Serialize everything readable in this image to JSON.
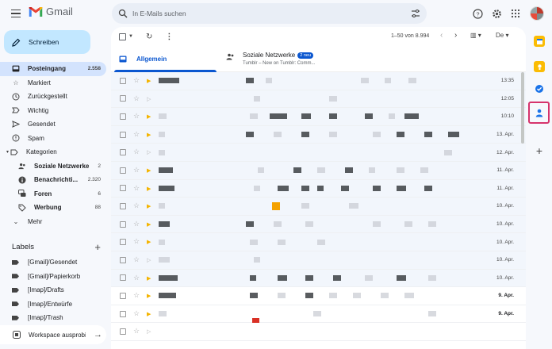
{
  "app": {
    "name": "Gmail"
  },
  "search": {
    "placeholder": "In E-Mails suchen"
  },
  "compose": {
    "label": "Schreiben"
  },
  "nav": [
    {
      "label": "Posteingang",
      "count": "2.558",
      "icon": "inbox-icon",
      "active": true
    },
    {
      "label": "Markiert",
      "count": "",
      "icon": "star-icon"
    },
    {
      "label": "Zurückgestellt",
      "count": "",
      "icon": "clock-icon"
    },
    {
      "label": "Wichtig",
      "count": "",
      "icon": "important-icon"
    },
    {
      "label": "Gesendet",
      "count": "",
      "icon": "send-icon"
    },
    {
      "label": "Spam",
      "count": "",
      "icon": "spam-icon"
    },
    {
      "label": "Kategorien",
      "count": "",
      "icon": "label-icon"
    }
  ],
  "categories": [
    {
      "label": "Soziale Netzwerke",
      "count": "2",
      "icon": "people-icon"
    },
    {
      "label": "Benachrichti...",
      "count": "2.320",
      "icon": "info-icon"
    },
    {
      "label": "Foren",
      "count": "6",
      "icon": "forum-icon"
    },
    {
      "label": "Werbung",
      "count": "88",
      "icon": "tag-icon"
    }
  ],
  "more": {
    "label": "Mehr"
  },
  "labels": {
    "title": "Labels",
    "items": [
      "[Gmail]/Gesendet",
      "[Gmail]/Papierkorb",
      "[Imap]/Drafts",
      "[Imap]/Entwürfe",
      "[Imap]/Trash"
    ]
  },
  "workspace": {
    "label": "Workspace ausprobieren"
  },
  "toolbar": {
    "pagination": "1–50 von 8.994",
    "lang": "De"
  },
  "tabs": {
    "primary": "Allgemein",
    "social": "Soziale Netzwerke",
    "social_badge": "2 neu",
    "social_sub": "Tumblr – New on Tumblr: Comm..."
  },
  "emails": [
    {
      "date": "13:35",
      "important": true,
      "read": true
    },
    {
      "date": "12:05",
      "important": false,
      "read": true
    },
    {
      "date": "10:10",
      "important": true,
      "read": true
    },
    {
      "date": "13. Apr.",
      "important": true,
      "read": true
    },
    {
      "date": "12. Apr.",
      "important": false,
      "read": true
    },
    {
      "date": "11. Apr.",
      "important": true,
      "read": true
    },
    {
      "date": "11. Apr.",
      "important": true,
      "read": true
    },
    {
      "date": "10. Apr.",
      "important": true,
      "read": true
    },
    {
      "date": "10. Apr.",
      "important": true,
      "read": true
    },
    {
      "date": "10. Apr.",
      "important": true,
      "read": true
    },
    {
      "date": "10. Apr.",
      "important": false,
      "read": true
    },
    {
      "date": "10. Apr.",
      "important": true,
      "read": true
    },
    {
      "date": "9. Apr.",
      "important": true,
      "read": false
    },
    {
      "date": "9. Apr.",
      "important": true,
      "read": false
    },
    {
      "date": "",
      "important": false,
      "read": false
    }
  ],
  "colors": {
    "accent": "#0b57d0",
    "compose_bg": "#c2e7ff",
    "active_nav": "#d3e3fd",
    "important": "#f4b400"
  }
}
